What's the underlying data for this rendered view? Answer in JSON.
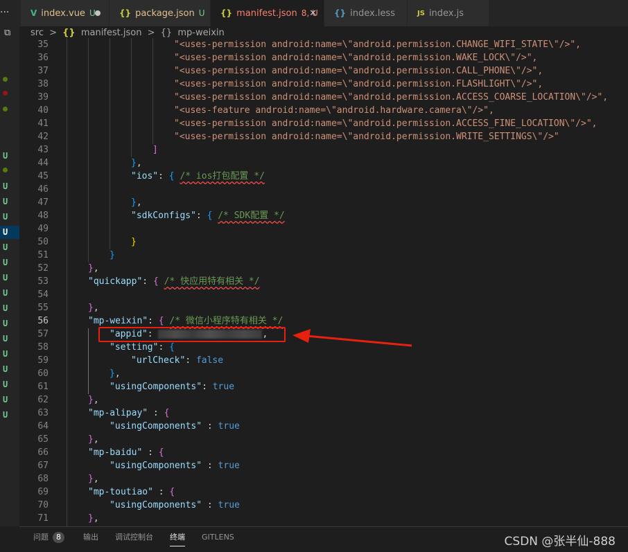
{
  "tabs": [
    {
      "label": "index.vue",
      "status": "U",
      "icon": "V",
      "icon_color": "#41b883",
      "dirty": true
    },
    {
      "label": "package.json",
      "status": "U",
      "icon": "{}",
      "icon_color": "#cbcb41"
    },
    {
      "label": "manifest.json",
      "status": "8, U",
      "icon": "{}",
      "icon_color": "#cbcb41",
      "active": true
    },
    {
      "label": "index.less",
      "icon": "{}",
      "icon_color": "#519aba"
    },
    {
      "label": "index.js",
      "icon": "JS",
      "icon_color": "#cbcb41"
    }
  ],
  "breadcrumb": {
    "folder": "src",
    "sep": ">",
    "file": "manifest.json",
    "symbol": "mp-weixin"
  },
  "code": {
    "p35": "\"<uses-permission android:name=\\\"android.permission.CHANGE_WIFI_STATE\\\"/>\",",
    "p36": "\"<uses-permission android:name=\\\"android.permission.WAKE_LOCK\\\"/>\",",
    "p37": "\"<uses-permission android:name=\\\"android.permission.CALL_PHONE\\\"/>\",",
    "p38": "\"<uses-permission android:name=\\\"android.permission.FLASHLIGHT\\\"/>\",",
    "p39": "\"<uses-permission android:name=\\\"android.permission.ACCESS_COARSE_LOCATION\\\"/>\",",
    "p40": "\"<uses-feature android:name=\\\"android.hardware.camera\\\"/>\",",
    "p41": "\"<uses-permission android:name=\\\"android.permission.ACCESS_FINE_LOCATION\\\"/>\",",
    "p42": "\"<uses-permission android:name=\\\"android.permission.WRITE_SETTINGS\\\"/>\"",
    "ios_key": "\"ios\"",
    "ios_comment": "/* ios打包配置 */",
    "sdk_key": "\"sdkConfigs\"",
    "sdk_comment": "/* SDK配置 */",
    "quickapp_key": "\"quickapp\"",
    "quickapp_comment": "/* 快应用特有相关 */",
    "weixin_key": "\"mp-weixin\"",
    "weixin_comment": "/* 微信小程序特有相关 */",
    "appid_key": "\"appid\"",
    "setting_key": "\"setting\"",
    "urlcheck_key": "\"urlCheck\"",
    "false_val": "false",
    "using_key": "\"usingComponents\"",
    "true_val": "true",
    "alipay_key": "\"mp-alipay\"",
    "baidu_key": "\"mp-baidu\"",
    "toutiao_key": "\"mp-toutiao\""
  },
  "line_numbers": [
    "35",
    "36",
    "37",
    "38",
    "39",
    "40",
    "41",
    "42",
    "43",
    "44",
    "45",
    "46",
    "47",
    "48",
    "49",
    "50",
    "51",
    "52",
    "53",
    "54",
    "55",
    "56",
    "57",
    "58",
    "59",
    "60",
    "61",
    "62",
    "63",
    "64",
    "65",
    "66",
    "67",
    "68",
    "69",
    "70",
    "71"
  ],
  "git_markers": "U",
  "panel": {
    "problems": "问题",
    "problems_count": "8",
    "output": "输出",
    "debug": "调试控制台",
    "terminal": "终端",
    "gitlens": "GITLENS"
  },
  "watermark": "CSDN @张半仙-888",
  "colors": {
    "annotation_red": "#e8210f",
    "accent": "#007acc"
  }
}
